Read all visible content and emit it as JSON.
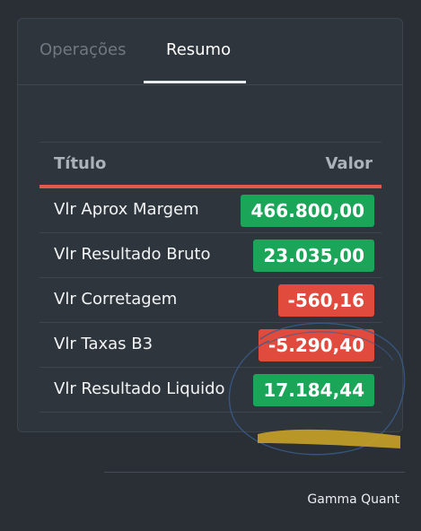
{
  "tabs": [
    {
      "label": "Operações",
      "active": false
    },
    {
      "label": "Resumo",
      "active": true
    }
  ],
  "table": {
    "headers": {
      "title": "Título",
      "value": "Valor"
    },
    "rows": [
      {
        "label": "Vlr Aprox Margem",
        "value": "466.800,00",
        "sign": "positive"
      },
      {
        "label": "Vlr Resultado Bruto",
        "value": "23.035,00",
        "sign": "positive"
      },
      {
        "label": "Vlr Corretagem",
        "value": "-560,16",
        "sign": "negative"
      },
      {
        "label": "Vlr Taxas B3",
        "value": "-5.290,40",
        "sign": "negative"
      },
      {
        "label": "Vlr Resultado Liquido",
        "value": "17.184,44",
        "sign": "positive"
      }
    ]
  },
  "footer": {
    "brand": "Gamma Quant"
  },
  "colors": {
    "background": "#2a2f35",
    "panel": "#2e353c",
    "positive": "#1aa558",
    "negative": "#e14b3d",
    "header_accent": "#e15a4c",
    "redaction_marker": "#c9a227",
    "pen_circle": "#3a5a8c"
  }
}
